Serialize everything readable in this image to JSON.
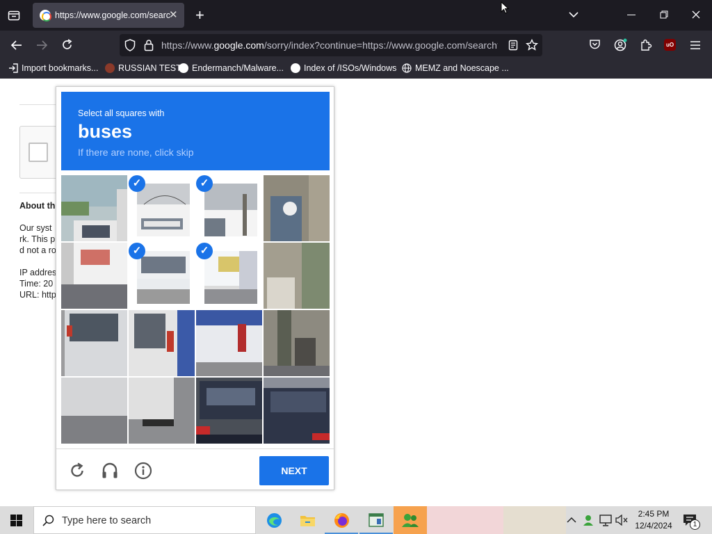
{
  "browser": {
    "tab_title": "https://www.google.com/search",
    "tab_close": "✕",
    "new_tab": "+",
    "url_pre": "https://www.",
    "url_domain": "google.com",
    "url_post": "/sorry/index?continue=https://www.google.com/search?",
    "bookmarks": [
      {
        "label": "Import bookmarks...",
        "icon": "import-icon"
      },
      {
        "label": "RUSSIAN TEST",
        "icon": "site-icon"
      },
      {
        "label": "Endermanch/Malware...",
        "icon": "google-icon"
      },
      {
        "label": "Index of /ISOs/Windows",
        "icon": "google-icon"
      },
      {
        "label": "MEMZ and Noescape ...",
        "icon": "globe-icon"
      }
    ],
    "accent_color": "#1c1b22"
  },
  "page": {
    "about_heading": "About th",
    "line1": "Our syst",
    "line2": "rk. This p",
    "line3": "d not a ro",
    "ip": "IP addres",
    "time": "Time: 20",
    "url": "URL: http"
  },
  "captcha": {
    "instruction": "Select all squares with",
    "target": "buses",
    "hint": "If there are none, click skip",
    "next_label": "NEXT",
    "selected_tiles": [
      1,
      2,
      5,
      6
    ],
    "check_mark": "✓",
    "header_color": "#1a73e8"
  },
  "taskbar": {
    "search_placeholder": "Type here to search",
    "time": "2:45 PM",
    "date": "12/4/2024",
    "notification_count": "1"
  }
}
